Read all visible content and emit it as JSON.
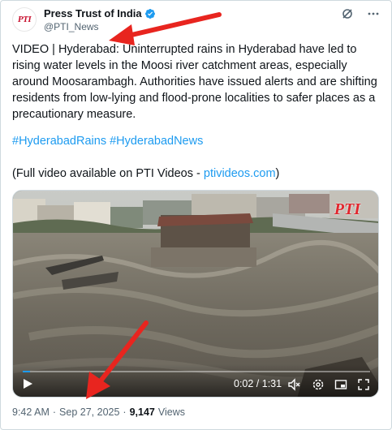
{
  "author": {
    "display_name": "Press Trust of India",
    "handle": "@PTI_News",
    "avatar_logo": "PTI",
    "avatar_subtext": "",
    "verified": true
  },
  "tweet": {
    "text": "VIDEO | Hyderabad: Uninterrupted rains in Hyderabad have led to rising water levels in the Moosi river catchment areas, especially around Moosarambagh. Authorities have issued alerts and are shifting residents from low-lying and flood-prone localities to safer places as a precautionary measure.",
    "hashtags": [
      "#HyderabadRains",
      "#HyderabadNews"
    ],
    "video_note_prefix": "(Full video available on PTI Videos - ",
    "video_note_link": "ptivideos.com",
    "video_note_suffix": ")"
  },
  "video": {
    "watermark": "PTI",
    "time_display": "0:02 / 1:31",
    "progress": 0.022
  },
  "meta": {
    "time": "9:42 AM",
    "separator": "·",
    "date": "Sep 27, 2025",
    "separator2": "·",
    "views_count": "9,147",
    "views_label": "Views"
  },
  "colors": {
    "accent": "#1d9bf0",
    "annotation_arrow": "#e8251f",
    "brand_red": "#c8102e"
  },
  "icons": [
    "verified-badge-icon",
    "grok-icon",
    "more-icon",
    "play-icon",
    "mute-icon",
    "settings-icon",
    "pip-icon",
    "fullscreen-icon"
  ]
}
